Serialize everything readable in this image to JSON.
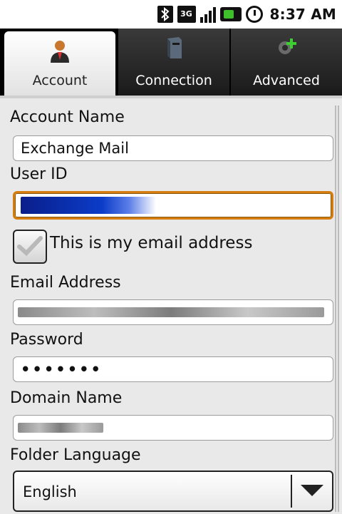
{
  "status_bar": {
    "bluetooth_icon": "bluetooth-icon",
    "network_label": "3G",
    "time": "8:37 AM"
  },
  "tabs": [
    {
      "label": "Account",
      "icon": "person-icon",
      "active": true
    },
    {
      "label": "Connection",
      "icon": "server-icon",
      "active": false
    },
    {
      "label": "Advanced",
      "icon": "gear-plus-icon",
      "active": false
    }
  ],
  "form": {
    "account_name_label": "Account Name",
    "account_name_value": "Exchange Mail",
    "user_id_label": "User ID",
    "email_checkbox_label": "This is my email address",
    "email_checkbox_checked": true,
    "email_label": "Email Address",
    "password_label": "Password",
    "password_value": "•••••••",
    "domain_label": "Domain Name",
    "folder_language_label": "Folder Language",
    "folder_language_value": "English"
  },
  "colors": {
    "focus_border": "#d67d10",
    "redaction_blue": "#0b3cc8"
  }
}
